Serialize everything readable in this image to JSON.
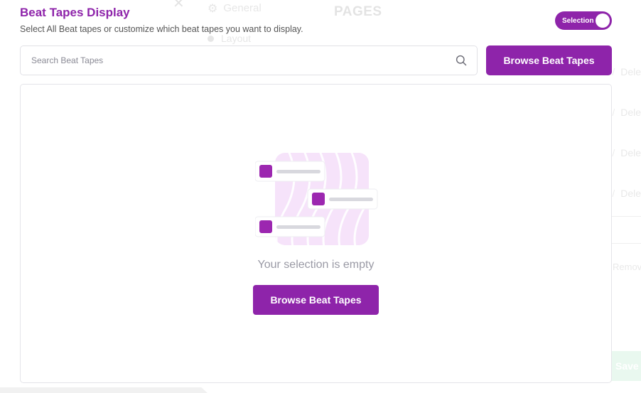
{
  "background": {
    "close_glyph": "✕",
    "general_label": "General",
    "layout_label": "Layout",
    "pages_heading": "PAGES",
    "delete_label": "Delete",
    "delete_rows": [
      "Dele",
      "Dele",
      "Dele",
      "Dele"
    ],
    "remove_label": "Remove",
    "save_label": "Save"
  },
  "modal": {
    "title": "Beat Tapes Display",
    "subtitle": "Select All Beat tapes or customize which beat tapes you want to display.",
    "toggle_label": "Selection",
    "search": {
      "placeholder": "Search Beat Tapes",
      "value": ""
    },
    "browse_button_label": "Browse Beat Tapes",
    "empty_state": {
      "message": "Your selection is empty",
      "button_label": "Browse Beat Tapes"
    }
  },
  "colors": {
    "accent": "#8e24aa",
    "accent_light": "#f6e3fa",
    "muted_text": "#9a9aa5",
    "border": "#e4e4e9"
  },
  "icons": {
    "search": "search-icon",
    "close": "close-icon",
    "gear": "gear-icon"
  }
}
